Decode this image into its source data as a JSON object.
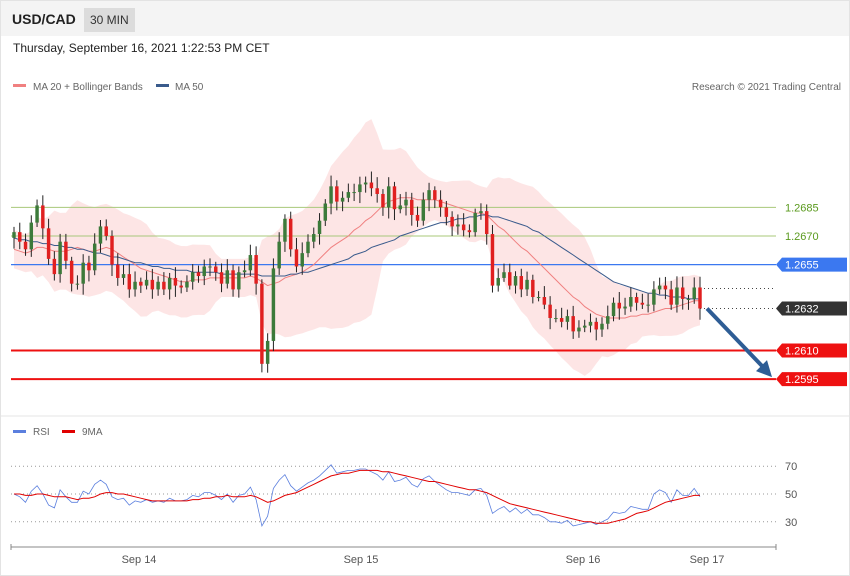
{
  "header": {
    "symbol": "USD/CAD",
    "timeframe": "30 MIN",
    "datetime": "Thursday, September 16, 2021 1:22:53 PM CET"
  },
  "legend": {
    "ma20_label": "MA 20 + Bollinger Bands",
    "ma20_color": "#f08080",
    "ma50_label": "MA 50",
    "ma50_color": "#3a5b8c",
    "copyright": "Research © 2021 Trading Central"
  },
  "rsi_legend": {
    "rsi_label": "RSI",
    "rsi_color": "#5b7fde",
    "ma_label": "9MA",
    "ma_color": "#e00000"
  },
  "chart_data": [
    {
      "type": "candlestick",
      "x_axis_ticks": [
        "Sep 14",
        "Sep 15",
        "Sep 16",
        "Sep 17"
      ],
      "ylim": [
        1.2583,
        1.2736
      ],
      "levels": [
        {
          "value": 1.2685,
          "label": "1.2685",
          "kind": "resistance-thin",
          "color": "#a8c87a",
          "text_color": "#5a9a1e"
        },
        {
          "value": 1.267,
          "label": "1.2670",
          "kind": "resistance-thin",
          "color": "#a8c87a",
          "text_color": "#5a9a1e"
        },
        {
          "value": 1.2655,
          "label": "1.2655",
          "kind": "pivot",
          "color": "#3b78f0",
          "text_color": "#ffffff"
        },
        {
          "value": 1.2632,
          "label": "1.2632",
          "kind": "last-price",
          "color": "#333333",
          "text_color": "#ffffff"
        },
        {
          "value": 1.261,
          "label": "1.2610",
          "kind": "support",
          "color": "#ee1111",
          "text_color": "#ffffff"
        },
        {
          "value": 1.2595,
          "label": "1.2595",
          "kind": "support",
          "color": "#ee1111",
          "text_color": "#ffffff"
        }
      ],
      "forecast_arrow": {
        "from": 1.2632,
        "to": 1.2595,
        "color": "#2e5d95"
      },
      "colors": {
        "up": "#3c7a3a",
        "down": "#e02020",
        "band": "#fde0e0"
      },
      "close": [
        1.2672,
        1.2667,
        1.2663,
        1.2677,
        1.2686,
        1.2674,
        1.2658,
        1.265,
        1.2667,
        1.2657,
        1.2645,
        1.2645,
        1.2656,
        1.2652,
        1.2666,
        1.2675,
        1.267,
        1.2655,
        1.2648,
        1.265,
        1.2642,
        1.2646,
        1.2644,
        1.2647,
        1.2642,
        1.2646,
        1.2642,
        1.2648,
        1.2644,
        1.2643,
        1.2646,
        1.2651,
        1.2649,
        1.2654,
        1.2654,
        1.2651,
        1.2645,
        1.2652,
        1.2642,
        1.2651,
        1.2652,
        1.266,
        1.2645,
        1.2603,
        1.2615,
        1.2653,
        1.2667,
        1.2679,
        1.2663,
        1.2654,
        1.2661,
        1.2667,
        1.2671,
        1.2678,
        1.2687,
        1.2696,
        1.2688,
        1.269,
        1.2693,
        1.2693,
        1.2697,
        1.2698,
        1.2695,
        1.2692,
        1.2685,
        1.2696,
        1.2684,
        1.2686,
        1.2689,
        1.2681,
        1.2678,
        1.2689,
        1.2694,
        1.2689,
        1.2685,
        1.268,
        1.2675,
        1.2676,
        1.2673,
        1.2672,
        1.2682,
        1.2683,
        1.2671,
        1.2644,
        1.2648,
        1.2651,
        1.2644,
        1.2649,
        1.2642,
        1.2647,
        1.2638,
        1.2638,
        1.2634,
        1.2627,
        1.2627,
        1.2625,
        1.2628,
        1.262,
        1.2622,
        1.2623,
        1.2625,
        1.2621,
        1.2624,
        1.2628,
        1.2635,
        1.2632,
        1.2633,
        1.2638,
        1.2635,
        1.2634,
        1.2634,
        1.2642,
        1.2644,
        1.2642,
        1.2634,
        1.2643,
        1.2637,
        1.2637,
        1.2643,
        1.2632
      ],
      "ma20": [
        1.2663,
        1.2662,
        1.2661,
        1.2662,
        1.2664,
        1.2664,
        1.2663,
        1.2662,
        1.2662,
        1.2662,
        1.2663,
        1.2664,
        1.2663,
        1.2662,
        1.2662,
        1.2663,
        1.2664,
        1.2663,
        1.2661,
        1.2659,
        1.2657,
        1.2655,
        1.2653,
        1.2652,
        1.2651,
        1.265,
        1.2649,
        1.2648,
        1.2647,
        1.2646,
        1.2646,
        1.2647,
        1.2647,
        1.2647,
        1.2648,
        1.2648,
        1.2648,
        1.2648,
        1.2648,
        1.2648,
        1.2648,
        1.2649,
        1.2648,
        1.2646,
        1.2644,
        1.2645,
        1.2646,
        1.2648,
        1.2649,
        1.265,
        1.2651,
        1.2653,
        1.2655,
        1.2658,
        1.2661,
        1.2664,
        1.2666,
        1.2668,
        1.267,
        1.2673,
        1.2675,
        1.2678,
        1.268,
        1.2683,
        1.2686,
        1.2688,
        1.2689,
        1.269,
        1.269,
        1.269,
        1.2689,
        1.2689,
        1.2689,
        1.2689,
        1.2688,
        1.2687,
        1.2686,
        1.2685,
        1.2684,
        1.2683,
        1.2682,
        1.2682,
        1.2681,
        1.2678,
        1.2675,
        1.2673,
        1.267,
        1.2667,
        1.2664,
        1.2662,
        1.2659,
        1.2656,
        1.2653,
        1.265,
        1.2647,
        1.2644,
        1.2641,
        1.2638,
        1.2636,
        1.2633,
        1.2631,
        1.2629,
        1.2628,
        1.2627,
        1.2627,
        1.2627,
        1.2627,
        1.2628,
        1.2628,
        1.2629,
        1.2629,
        1.263,
        1.2631,
        1.2632,
        1.2632,
        1.2633,
        1.2634,
        1.2635,
        1.2636,
        1.2636
      ],
      "ma50": [
        1.2669,
        1.2668,
        1.2668,
        1.2667,
        1.2667,
        1.2666,
        1.2666,
        1.2665,
        1.2665,
        1.2664,
        1.2664,
        1.2663,
        1.2663,
        1.2662,
        1.2661,
        1.2661,
        1.266,
        1.2659,
        1.2659,
        1.2658,
        1.2657,
        1.2656,
        1.2656,
        1.2655,
        1.2654,
        1.2654,
        1.2653,
        1.2653,
        1.2652,
        1.2652,
        1.2652,
        1.2651,
        1.2651,
        1.2651,
        1.2651,
        1.2651,
        1.265,
        1.265,
        1.265,
        1.265,
        1.265,
        1.265,
        1.265,
        1.2649,
        1.2649,
        1.2649,
        1.2649,
        1.2649,
        1.265,
        1.265,
        1.2651,
        1.2651,
        1.2652,
        1.2653,
        1.2654,
        1.2655,
        1.2656,
        1.2657,
        1.2658,
        1.266,
        1.2661,
        1.2662,
        1.2664,
        1.2665,
        1.2666,
        1.2667,
        1.2668,
        1.267,
        1.2671,
        1.2672,
        1.2673,
        1.2674,
        1.2675,
        1.2676,
        1.2677,
        1.2677,
        1.2678,
        1.2679,
        1.2679,
        1.268,
        1.268,
        1.2681,
        1.2681,
        1.268,
        1.268,
        1.2679,
        1.2678,
        1.2677,
        1.2676,
        1.2675,
        1.2673,
        1.2672,
        1.267,
        1.2668,
        1.2666,
        1.2664,
        1.2662,
        1.266,
        1.2658,
        1.2656,
        1.2654,
        1.2652,
        1.265,
        1.2648,
        1.2646,
        1.2645,
        1.2644,
        1.2643,
        1.2642,
        1.2641,
        1.264,
        1.264,
        1.2639,
        1.2639,
        1.2638,
        1.2638,
        1.2638,
        1.2637,
        1.2637,
        1.2637
      ]
    },
    {
      "type": "line",
      "name": "RSI",
      "yticks": [
        30,
        50,
        70
      ],
      "ylim": [
        14,
        86
      ],
      "rsi": [
        50,
        48,
        44,
        52,
        56,
        50,
        42,
        40,
        53,
        48,
        44,
        44,
        52,
        50,
        57,
        60,
        57,
        48,
        46,
        47,
        42,
        45,
        44,
        46,
        44,
        45,
        44,
        47,
        45,
        45,
        46,
        49,
        48,
        51,
        51,
        49,
        46,
        50,
        44,
        49,
        50,
        55,
        46,
        27,
        34,
        54,
        60,
        64,
        56,
        52,
        55,
        58,
        60,
        63,
        67,
        71,
        65,
        66,
        67,
        67,
        68,
        68,
        66,
        64,
        60,
        66,
        59,
        60,
        62,
        57,
        55,
        61,
        63,
        59,
        56,
        53,
        51,
        51,
        50,
        49,
        53,
        54,
        49,
        36,
        39,
        41,
        37,
        40,
        36,
        39,
        35,
        35,
        33,
        30,
        30,
        29,
        31,
        27,
        28,
        29,
        30,
        28,
        30,
        32,
        37,
        36,
        37,
        41,
        40,
        39,
        39,
        50,
        53,
        51,
        44,
        53,
        49,
        49,
        54,
        48
      ],
      "ma9": [
        50,
        50,
        49,
        49,
        50,
        50,
        49,
        48,
        48,
        48,
        47,
        46,
        47,
        47,
        48,
        50,
        51,
        51,
        50,
        50,
        49,
        48,
        47,
        46,
        45,
        45,
        45,
        45,
        45,
        45,
        45,
        46,
        46,
        47,
        47,
        48,
        48,
        49,
        48,
        48,
        48,
        49,
        48,
        46,
        44,
        45,
        47,
        49,
        50,
        51,
        53,
        55,
        57,
        59,
        61,
        63,
        64,
        65,
        65,
        66,
        67,
        67,
        67,
        67,
        66,
        66,
        65,
        64,
        63,
        62,
        61,
        60,
        59,
        59,
        58,
        57,
        56,
        55,
        54,
        53,
        53,
        52,
        51,
        49,
        47,
        45,
        43,
        42,
        41,
        40,
        39,
        38,
        37,
        36,
        35,
        34,
        33,
        32,
        31,
        30,
        30,
        29,
        29,
        29,
        30,
        31,
        32,
        34,
        36,
        37,
        38,
        40,
        42,
        44,
        45,
        46,
        47,
        48,
        49,
        49
      ]
    }
  ]
}
